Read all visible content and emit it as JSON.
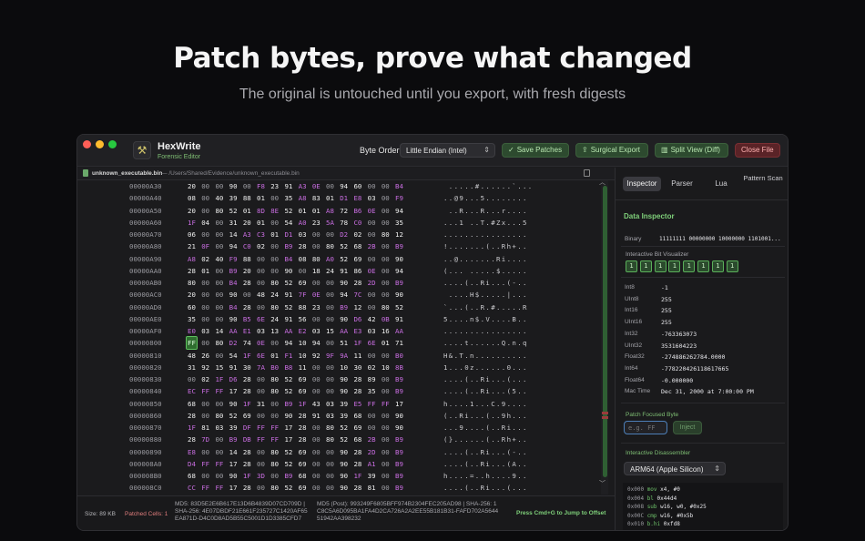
{
  "hero": {
    "title": "Patch bytes, prove what changed",
    "subtitle": "The original is untouched until you export, with fresh digests"
  },
  "app": {
    "name": "HexWrite",
    "subtitle": "Forensic Editor",
    "byte_order_label": "Byte Order",
    "byte_order_value": "Little Endian (Intel)",
    "buttons": {
      "save": "Save Patches",
      "export": "Surgical Export",
      "split": "Split View (Diff)",
      "close": "Close File"
    }
  },
  "path": {
    "file": "unknown_executable.bin",
    "separator": "—",
    "full": "/Users/Shared/Evidence/unknown_executable.bin"
  },
  "hex_rows": [
    {
      "offset": "00000A30",
      "bytes": [
        "20",
        "00",
        "00",
        "90",
        "00",
        "F8",
        "23",
        "91",
        "A3",
        "0E",
        "00",
        "94",
        "60",
        "00",
        "00",
        "B4"
      ],
      "ascii": " .....#......`..."
    },
    {
      "offset": "00000A40",
      "bytes": [
        "08",
        "00",
        "40",
        "39",
        "88",
        "01",
        "00",
        "35",
        "A8",
        "83",
        "01",
        "D1",
        "E8",
        "03",
        "00",
        "F9"
      ],
      "ascii": "..@9...5........"
    },
    {
      "offset": "00000A50",
      "bytes": [
        "20",
        "00",
        "80",
        "52",
        "01",
        "8D",
        "8E",
        "52",
        "01",
        "01",
        "A8",
        "72",
        "B6",
        "0E",
        "00",
        "94"
      ],
      "ascii": " ..R...R...r...."
    },
    {
      "offset": "00000A60",
      "bytes": [
        "1F",
        "04",
        "00",
        "31",
        "20",
        "01",
        "00",
        "54",
        "A0",
        "23",
        "5A",
        "78",
        "C0",
        "00",
        "00",
        "35"
      ],
      "ascii": "...1 ..T.#Zx...5"
    },
    {
      "offset": "00000A70",
      "bytes": [
        "06",
        "00",
        "00",
        "14",
        "A3",
        "C3",
        "01",
        "D1",
        "03",
        "00",
        "00",
        "D2",
        "02",
        "00",
        "80",
        "12"
      ],
      "ascii": "................"
    },
    {
      "offset": "00000A80",
      "bytes": [
        "21",
        "0F",
        "00",
        "94",
        "C0",
        "02",
        "00",
        "B9",
        "28",
        "00",
        "80",
        "52",
        "68",
        "2B",
        "00",
        "B9"
      ],
      "ascii": "!.......(..Rh+.."
    },
    {
      "offset": "00000A90",
      "bytes": [
        "A8",
        "02",
        "40",
        "F9",
        "88",
        "00",
        "00",
        "B4",
        "08",
        "80",
        "A0",
        "52",
        "69",
        "00",
        "00",
        "90"
      ],
      "ascii": "..@.......Ri...."
    },
    {
      "offset": "00000AA0",
      "bytes": [
        "28",
        "01",
        "00",
        "B9",
        "20",
        "00",
        "00",
        "90",
        "00",
        "18",
        "24",
        "91",
        "86",
        "0E",
        "00",
        "94"
      ],
      "ascii": "(... .....$....."
    },
    {
      "offset": "00000AB0",
      "bytes": [
        "80",
        "00",
        "00",
        "B4",
        "28",
        "00",
        "80",
        "52",
        "69",
        "00",
        "00",
        "90",
        "28",
        "2D",
        "00",
        "B9"
      ],
      "ascii": "....(..Ri...(-.."
    },
    {
      "offset": "00000AC0",
      "bytes": [
        "20",
        "00",
        "00",
        "90",
        "00",
        "48",
        "24",
        "91",
        "7F",
        "0E",
        "00",
        "94",
        "7C",
        "00",
        "00",
        "90"
      ],
      "ascii": " ....H$.....|..."
    },
    {
      "offset": "00000AD0",
      "bytes": [
        "60",
        "00",
        "00",
        "B4",
        "28",
        "00",
        "80",
        "52",
        "88",
        "23",
        "00",
        "B9",
        "12",
        "00",
        "80",
        "52"
      ],
      "ascii": "`...(..R.#.....R"
    },
    {
      "offset": "00000AE0",
      "bytes": [
        "35",
        "00",
        "00",
        "90",
        "B5",
        "6E",
        "24",
        "91",
        "56",
        "00",
        "00",
        "90",
        "D6",
        "42",
        "0B",
        "91"
      ],
      "ascii": "5....n$.V....B.."
    },
    {
      "offset": "00000AF0",
      "bytes": [
        "E0",
        "03",
        "14",
        "AA",
        "E1",
        "03",
        "13",
        "AA",
        "E2",
        "03",
        "15",
        "AA",
        "E3",
        "03",
        "16",
        "AA"
      ],
      "ascii": "................"
    },
    {
      "offset": "00000800",
      "bytes": [
        "FF",
        "00",
        "80",
        "D2",
        "74",
        "0E",
        "00",
        "94",
        "10",
        "94",
        "00",
        "51",
        "1F",
        "6E",
        "01",
        "71"
      ],
      "ascii": "....t......Q.n.q"
    },
    {
      "offset": "00000810",
      "bytes": [
        "48",
        "26",
        "00",
        "54",
        "1F",
        "6E",
        "01",
        "F1",
        "10",
        "92",
        "9F",
        "9A",
        "11",
        "00",
        "00",
        "B0"
      ],
      "ascii": "H&.T.n.........."
    },
    {
      "offset": "00000820",
      "bytes": [
        "31",
        "92",
        "15",
        "91",
        "30",
        "7A",
        "B0",
        "B8",
        "11",
        "00",
        "00",
        "10",
        "30",
        "02",
        "10",
        "8B"
      ],
      "ascii": "1...0z......0..."
    },
    {
      "offset": "00000830",
      "bytes": [
        "00",
        "02",
        "1F",
        "D6",
        "28",
        "00",
        "80",
        "52",
        "69",
        "00",
        "00",
        "90",
        "28",
        "89",
        "00",
        "B9"
      ],
      "ascii": "....(..Ri...(..."
    },
    {
      "offset": "00000840",
      "bytes": [
        "EC",
        "FF",
        "FF",
        "17",
        "28",
        "00",
        "80",
        "52",
        "69",
        "00",
        "00",
        "90",
        "28",
        "35",
        "00",
        "B9"
      ],
      "ascii": "....(..Ri...(5.."
    },
    {
      "offset": "00000850",
      "bytes": [
        "68",
        "00",
        "00",
        "90",
        "1F",
        "31",
        "00",
        "B9",
        "1F",
        "43",
        "03",
        "39",
        "E5",
        "FF",
        "FF",
        "17"
      ],
      "ascii": "h....1...C.9...."
    },
    {
      "offset": "00000860",
      "bytes": [
        "28",
        "00",
        "80",
        "52",
        "69",
        "00",
        "00",
        "90",
        "28",
        "91",
        "03",
        "39",
        "68",
        "00",
        "00",
        "90"
      ],
      "ascii": "(..Ri...(..9h..."
    },
    {
      "offset": "00000870",
      "bytes": [
        "1F",
        "81",
        "03",
        "39",
        "DF",
        "FF",
        "FF",
        "17",
        "28",
        "00",
        "80",
        "52",
        "69",
        "00",
        "00",
        "90"
      ],
      "ascii": "...9....(..Ri..."
    },
    {
      "offset": "00000880",
      "bytes": [
        "28",
        "7D",
        "00",
        "B9",
        "DB",
        "FF",
        "FF",
        "17",
        "28",
        "00",
        "80",
        "52",
        "68",
        "2B",
        "00",
        "B9"
      ],
      "ascii": "(}......(..Rh+.."
    },
    {
      "offset": "00000890",
      "bytes": [
        "E8",
        "00",
        "00",
        "14",
        "28",
        "00",
        "80",
        "52",
        "69",
        "00",
        "00",
        "90",
        "28",
        "2D",
        "00",
        "B9"
      ],
      "ascii": "....(..Ri...(-.."
    },
    {
      "offset": "000008A0",
      "bytes": [
        "D4",
        "FF",
        "FF",
        "17",
        "28",
        "00",
        "80",
        "52",
        "69",
        "00",
        "00",
        "90",
        "28",
        "A1",
        "00",
        "B9"
      ],
      "ascii": "....(..Ri...(A.."
    },
    {
      "offset": "000008B0",
      "bytes": [
        "68",
        "00",
        "00",
        "90",
        "1F",
        "3D",
        "00",
        "B9",
        "68",
        "00",
        "00",
        "90",
        "1F",
        "39",
        "00",
        "B9"
      ],
      "ascii": "h....=..h....9.."
    },
    {
      "offset": "000008C0",
      "bytes": [
        "CC",
        "FF",
        "FF",
        "17",
        "28",
        "00",
        "80",
        "52",
        "69",
        "00",
        "00",
        "90",
        "28",
        "81",
        "00",
        "B9"
      ],
      "ascii": "....(..Ri...(..."
    }
  ],
  "status": {
    "size": "Size: 89 KB",
    "patched": "Patched Cells: 1",
    "md5_pre": "MD5: 83D5E2E6B617E13D6B4839D07CD709D | SHA-256: 4E07DBDF21E661F235727C1420AF65EA871D-D4C0D8AD5B55C5001D1D3385CFD7",
    "md5_post": "MD5 (Post): 993249F6805BFF974B2304FEC205AD98 | SHA-256: 1C8C5A6D095BA1FA4D2CA726A2A2EE55B181B31-FAFD702A564451942AA398232",
    "jump": "Press Cmd+G to Jump to Offset"
  },
  "inspector": {
    "tabs": [
      "Inspector",
      "Parser",
      "Lua",
      "Pattern Scan"
    ],
    "title": "Data Inspector",
    "binary_label": "Binary",
    "binary_value": "11111111 00000000 10000000 1101001...",
    "bit_vis_label": "Interactive Bit Visualizer",
    "bits": [
      "1",
      "1",
      "1",
      "1",
      "1",
      "1",
      "1",
      "1"
    ],
    "values": [
      {
        "k": "Int8",
        "v": "-1"
      },
      {
        "k": "UInt8",
        "v": "255"
      },
      {
        "k": "Int16",
        "v": "255"
      },
      {
        "k": "UInt16",
        "v": "255"
      },
      {
        "k": "Int32",
        "v": "-763363073"
      },
      {
        "k": "UInt32",
        "v": "3531604223"
      },
      {
        "k": "Float32",
        "v": "-274886262784.0000"
      },
      {
        "k": "Int64",
        "v": "-778220426118617665"
      },
      {
        "k": "Float64",
        "v": "-0.000000"
      },
      {
        "k": "Mac Time",
        "v": "Dec 31, 2000 at 7:00:00 PM"
      }
    ],
    "patch_label": "Patch Focused Byte",
    "patch_placeholder": "e.g. FF",
    "inject_label": "Inject",
    "disasm_label": "Interactive Disassembler",
    "arch_value": "ARM64 (Apple Silicon)",
    "disasm": [
      {
        "addr": "0x000",
        "mn": "mov",
        "ops": "x4, #0"
      },
      {
        "addr": "0x004",
        "mn": "bl",
        "ops": "0x44d4"
      },
      {
        "addr": "0x008",
        "mn": "sub",
        "ops": "w16, w0, #0x25"
      },
      {
        "addr": "0x00C",
        "mn": "cmp",
        "ops": "w16, #0x5b"
      },
      {
        "addr": "0x010",
        "mn": "b.hi",
        "ops": "0xfd8"
      }
    ]
  },
  "colors": {
    "accent_green": "#7fd07a",
    "byte_purple": "#c86de0",
    "close_red": "#5a2327"
  }
}
